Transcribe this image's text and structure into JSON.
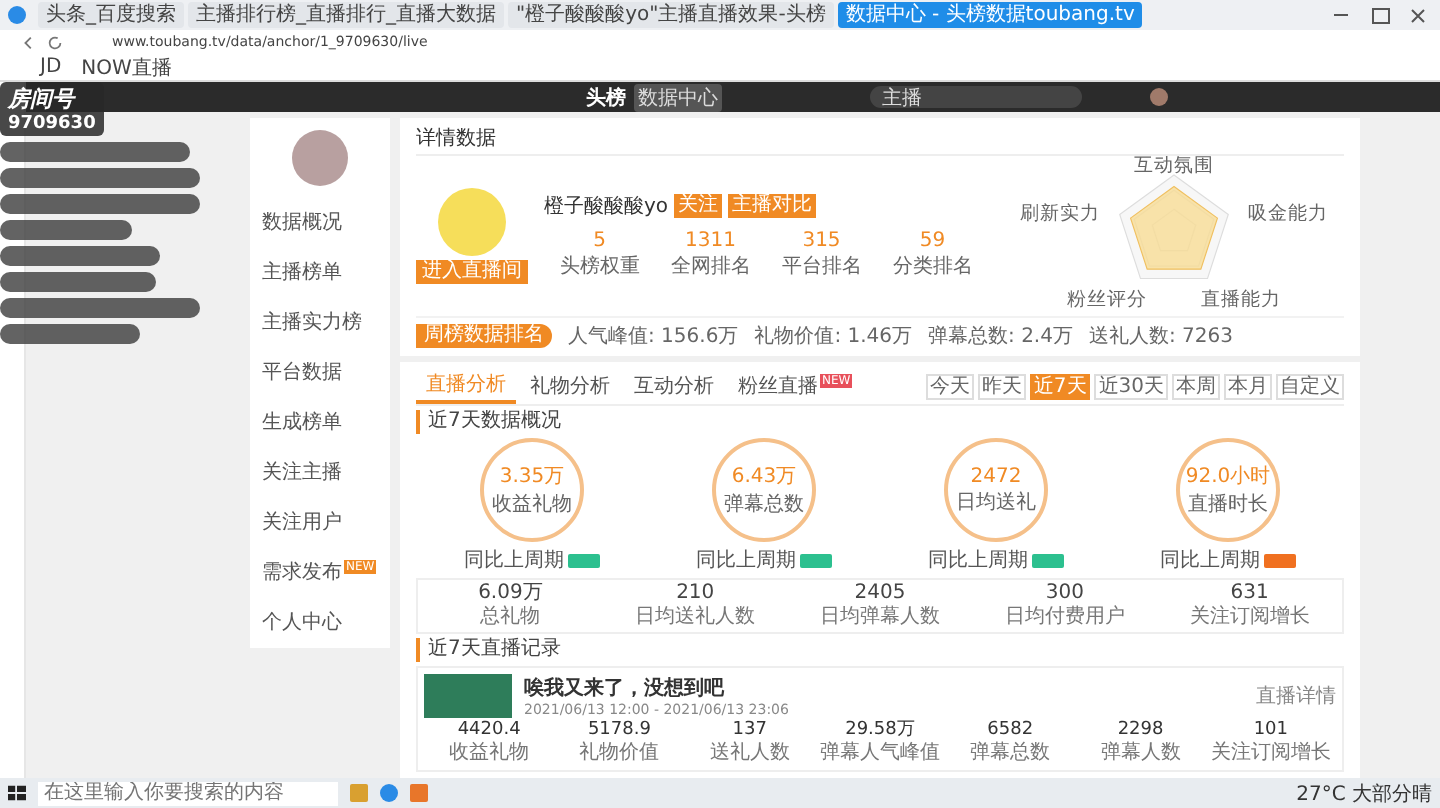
{
  "browser": {
    "tabs": [
      {
        "title": "头条_百度搜索",
        "selected": false
      },
      {
        "title": "主播排行榜_直播排行_直播大数据",
        "selected": false
      },
      {
        "title": "\"橙子酸酸酸yo\"主播直播效果-头榜",
        "selected": false
      },
      {
        "title": "数据中心 - 头榜数据toubang.tv",
        "selected": true
      }
    ],
    "url": "www.toubang.tv/data/anchor/1_9709630/live",
    "bookmarks": [
      "JD",
      "NOW直播"
    ]
  },
  "overlay": {
    "room_label": "房间号",
    "room_number": "9709630"
  },
  "site": {
    "logo": "头榜",
    "badge": "数据中心",
    "search_scope": "主播"
  },
  "sidebar": {
    "menu": [
      {
        "label": "数据概况"
      },
      {
        "label": "主播榜单"
      },
      {
        "label": "主播实力榜"
      },
      {
        "label": "平台数据"
      },
      {
        "label": "生成榜单"
      },
      {
        "label": "关注主播"
      },
      {
        "label": "关注用户"
      },
      {
        "label": "需求发布",
        "badge": "NEW"
      },
      {
        "label": "个人中心"
      }
    ]
  },
  "detail": {
    "title": "详情数据",
    "name": "橙子酸酸酸yo",
    "tags": [
      "关注",
      "主播对比"
    ],
    "enter_button": "进入直播间",
    "stats": [
      {
        "value": "5",
        "label": "头榜权重"
      },
      {
        "value": "1311",
        "label": "全网排名"
      },
      {
        "value": "315",
        "label": "平台排名"
      },
      {
        "value": "59",
        "label": "分类排名"
      }
    ],
    "radar_labels": [
      "互动氛围",
      "吸金能力",
      "直播能力",
      "粉丝评分",
      "刷新实力"
    ],
    "rank_button": "周榜数据排名",
    "summary": [
      {
        "label": "人气峰值:",
        "value": "156.6万"
      },
      {
        "label": "礼物价值:",
        "value": "1.46万"
      },
      {
        "label": "弹幕总数:",
        "value": "2.4万"
      },
      {
        "label": "送礼人数:",
        "value": "7263"
      }
    ]
  },
  "analysis": {
    "tabs": [
      {
        "label": "直播分析",
        "selected": true
      },
      {
        "label": "礼物分析",
        "selected": false
      },
      {
        "label": "互动分析",
        "selected": false
      },
      {
        "label": "粉丝直播",
        "selected": false,
        "badge": "NEW"
      }
    ],
    "ranges": [
      {
        "label": "今天",
        "selected": false
      },
      {
        "label": "昨天",
        "selected": false
      },
      {
        "label": "近7天",
        "selected": true
      },
      {
        "label": "近30天",
        "selected": false
      },
      {
        "label": "本周",
        "selected": false
      },
      {
        "label": "本月",
        "selected": false
      },
      {
        "label": "自定义",
        "selected": false
      }
    ],
    "overview_title": "近7天数据概况",
    "circles": [
      {
        "value": "3.35万",
        "label": "收益礼物",
        "compare": "同比上周期",
        "color": "#2cc08f"
      },
      {
        "value": "6.43万",
        "label": "弹幕总数",
        "compare": "同比上周期",
        "color": "#2cc08f"
      },
      {
        "value": "2472",
        "label": "日均送礼",
        "compare": "同比上周期",
        "color": "#2cc08f"
      },
      {
        "value": "92.0小时",
        "label": "直播时长",
        "compare": "同比上周期",
        "color": "#f07020"
      }
    ],
    "totals": [
      {
        "value": "6.09万",
        "label": "总礼物"
      },
      {
        "value": "210",
        "label": "日均送礼人数"
      },
      {
        "value": "2405",
        "label": "日均弹幕人数"
      },
      {
        "value": "300",
        "label": "日均付费用户"
      },
      {
        "value": "631",
        "label": "关注订阅增长"
      }
    ],
    "records_title": "近7天直播记录",
    "record": {
      "title": "唉我又来了，没想到吧",
      "time": "2021/06/13 12:00 - 2021/06/13 23:06",
      "detail_link": "直播详情",
      "stats": [
        {
          "value": "4420.4",
          "label": "收益礼物"
        },
        {
          "value": "5178.9",
          "label": "礼物价值"
        },
        {
          "value": "137",
          "label": "送礼人数"
        },
        {
          "value": "29.58万",
          "label": "弹幕人气峰值"
        },
        {
          "value": "6582",
          "label": "弹幕总数"
        },
        {
          "value": "2298",
          "label": "弹幕人数"
        },
        {
          "value": "101",
          "label": "关注订阅增长"
        }
      ]
    }
  },
  "taskbar": {
    "search_placeholder": "在这里输入你要搜索的内容",
    "weather": "27°C 大部分晴"
  }
}
